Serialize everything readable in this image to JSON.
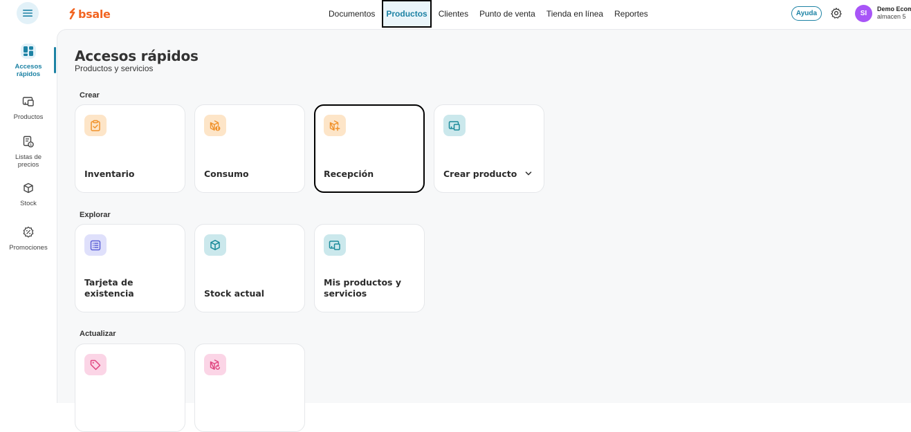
{
  "app": {
    "brand": "bsale"
  },
  "nav": {
    "items": [
      {
        "label": "Documentos",
        "active": false
      },
      {
        "label": "Productos",
        "active": true
      },
      {
        "label": "Clientes",
        "active": false
      },
      {
        "label": "Punto de venta",
        "active": false
      },
      {
        "label": "Tienda en línea",
        "active": false
      },
      {
        "label": "Reportes",
        "active": false
      }
    ]
  },
  "header": {
    "help_label": "Ayuda",
    "avatar_initials": "SI",
    "user_name": "Demo Ecom",
    "user_store": "almacen 5"
  },
  "sidebar": {
    "items": [
      {
        "label": "Accesos rápidos",
        "icon": "grid-icon",
        "active": true
      },
      {
        "label": "Productos",
        "icon": "products-icon",
        "active": false
      },
      {
        "label": "Listas de precios",
        "icon": "price-list-icon",
        "active": false
      },
      {
        "label": "Stock",
        "icon": "box-icon",
        "active": false
      },
      {
        "label": "Promociones",
        "icon": "promo-icon",
        "active": false
      }
    ]
  },
  "page": {
    "title": "Accesos rápidos",
    "subtitle": "Productos y servicios"
  },
  "sections": [
    {
      "label": "Crear",
      "cards": [
        {
          "title": "Inventario",
          "icon": "clipboard-check-icon",
          "color": "orange"
        },
        {
          "title": "Consumo",
          "icon": "box-alert-icon",
          "color": "orange"
        },
        {
          "title": "Recepción",
          "icon": "box-plus-icon",
          "color": "orange"
        },
        {
          "title": "Crear producto",
          "icon": "products-icon",
          "color": "teal",
          "has_chevron": true
        }
      ]
    },
    {
      "label": "Explorar",
      "cards": [
        {
          "title": "Tarjeta de existencia",
          "icon": "list-icon",
          "color": "violet"
        },
        {
          "title": "Stock actual",
          "icon": "box-icon",
          "color": "teal"
        },
        {
          "title": "Mis productos y servicios",
          "icon": "products-icon",
          "color": "teal"
        }
      ]
    },
    {
      "label": "Actualizar",
      "cards": [
        {
          "title": "",
          "icon": "tag-icon",
          "color": "pink"
        },
        {
          "title": "",
          "icon": "box-refresh-icon",
          "color": "pink"
        }
      ]
    }
  ],
  "colors": {
    "accent": "#1c82a4",
    "brand": "#f26522",
    "orange_icon": "#f0922b",
    "teal_icon": "#1a8a99",
    "violet_icon": "#5b5fd6",
    "pink_icon": "#e0457f"
  }
}
